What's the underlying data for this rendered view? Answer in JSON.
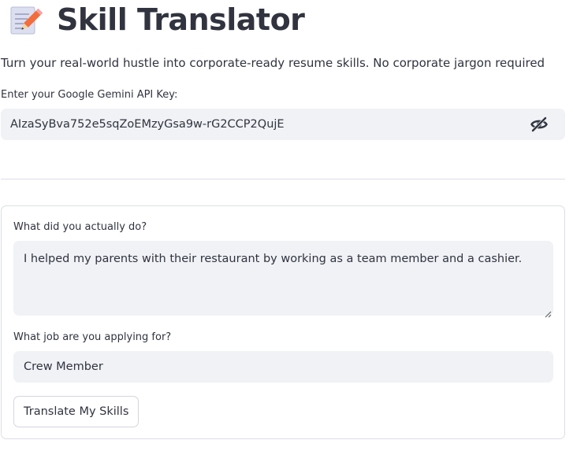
{
  "header": {
    "icon": "memo-icon",
    "title": "Skill Translator"
  },
  "subtitle": "Turn your real-world hustle into corporate-ready resume skills. No corporate jargon required",
  "api_key": {
    "label": "Enter your Google Gemini API Key:",
    "value": "AIzaSyBva752e5sqZoEMzyGsa9w-rG2CCP2QujE",
    "visibility_icon": "eye-slash-icon"
  },
  "form": {
    "experience": {
      "label": "What did you actually do?",
      "value": "I helped my parents with their restaurant by working as a team member and a cashier."
    },
    "job": {
      "label": "What job are you applying for?",
      "value": "Crew Member"
    },
    "submit_label": "Translate My Skills"
  },
  "colors": {
    "text": "#31333f",
    "field_bg": "#f0f2f6",
    "border": "#dcdee3"
  }
}
